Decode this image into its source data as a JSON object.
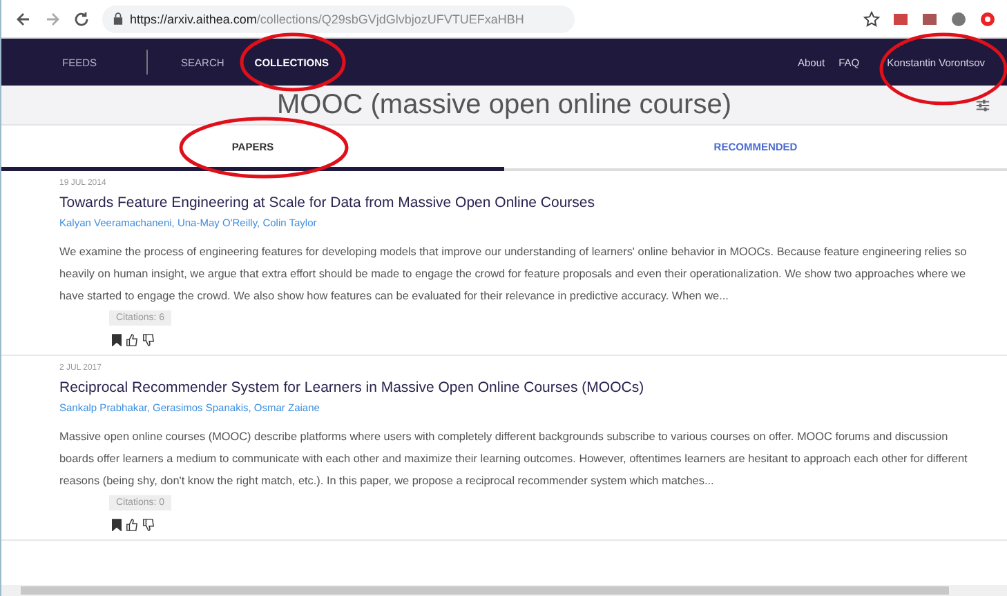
{
  "browser": {
    "url_host": "https://arxiv.aithea.com",
    "url_path": "/collections/Q29sbGVjdGlvbjozUFVTUEFxaHBH"
  },
  "nav": {
    "left": [
      {
        "label": "FEEDS",
        "selected": false
      },
      {
        "label": "SEARCH",
        "selected": false
      },
      {
        "label": "COLLECTIONS",
        "selected": true
      }
    ],
    "right": [
      {
        "label": "About"
      },
      {
        "label": "FAQ"
      },
      {
        "label": "Konstantin Vorontsov"
      }
    ]
  },
  "collection_title": "MOOC (massive open online course)",
  "tabs": [
    {
      "label": "PAPERS",
      "selected": true
    },
    {
      "label": "RECOMMENDED",
      "selected": false
    }
  ],
  "papers": [
    {
      "date": "19 JUL 2014",
      "title": "Towards Feature Engineering at Scale for Data from Massive Open Online Courses",
      "authors": "Kalyan Veeramachaneni, Una-May O'Reilly, Colin Taylor",
      "abstract": "We examine the process of engineering features for developing models that improve our understanding of learners' online behavior in MOOCs. Because feature engineering relies so heavily on human insight, we argue that extra effort should be made to engage the crowd for feature proposals and even their operationalization. We show two approaches where we have started to engage the crowd. We also show how features can be evaluated for their relevance in predictive accuracy. When we...",
      "citations": "Citations: 6",
      "bookmarked": true
    },
    {
      "date": "2 JUL 2017",
      "title": "Reciprocal Recommender System for Learners in Massive Open Online Courses (MOOCs)",
      "authors": "Sankalp Prabhakar, Gerasimos Spanakis, Osmar Zaiane",
      "abstract": "Massive open online courses (MOOC) describe platforms where users with completely different backgrounds subscribe to various courses on offer. MOOC forums and discussion boards offer learners a medium to communicate with each other and maximize their learning outcomes. However, oftentimes learners are hesitant to approach each other for different reasons (being shy, don't know the right match, etc.). In this paper, we propose a reciprocal recommender system which matches...",
      "citations": "Citations: 0",
      "bookmarked": true
    }
  ]
}
